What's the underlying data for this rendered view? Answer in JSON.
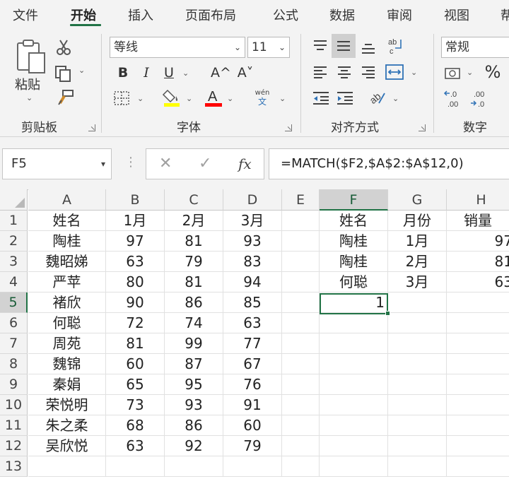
{
  "ribbon": {
    "tabs": [
      "文件",
      "开始",
      "插入",
      "页面布局",
      "公式",
      "数据",
      "审阅",
      "视图",
      "帮"
    ],
    "active_tab": "开始",
    "clipboard": {
      "paste_label": "粘贴",
      "group_label": "剪贴板"
    },
    "font": {
      "name": "等线",
      "size": "11",
      "bold": "B",
      "italic": "I",
      "underline": "U",
      "grow": "A^",
      "shrink": "A˅",
      "phonetic_top": "wén",
      "phonetic_bottom": "文",
      "group_label": "字体",
      "fill_color": "#ffff00",
      "font_color": "#ff0000"
    },
    "alignment": {
      "group_label": "对齐方式"
    },
    "number": {
      "format": "常规",
      "percent": "%",
      "group_label": "数字"
    }
  },
  "formula_bar": {
    "name_box": "F5",
    "cancel": "✕",
    "enter": "✓",
    "fx": "fx",
    "formula": "=MATCH($F2,$A$2:$A$12,0)"
  },
  "sheet": {
    "columns": [
      "A",
      "B",
      "C",
      "D",
      "E",
      "F",
      "G",
      "H"
    ],
    "selected_column": "F",
    "rows": [
      "1",
      "2",
      "3",
      "4",
      "5",
      "6",
      "7",
      "8",
      "9",
      "10",
      "11",
      "12",
      "13"
    ],
    "selected_row": "5",
    "table": [
      [
        "姓名",
        "1月",
        "2月",
        "3月"
      ],
      [
        "陶桂",
        "97",
        "81",
        "93"
      ],
      [
        "魏昭娣",
        "63",
        "79",
        "83"
      ],
      [
        "严苹",
        "80",
        "81",
        "94"
      ],
      [
        "褚欣",
        "90",
        "86",
        "85"
      ],
      [
        "何聪",
        "72",
        "74",
        "63"
      ],
      [
        "周苑",
        "81",
        "99",
        "77"
      ],
      [
        "魏锦",
        "60",
        "87",
        "67"
      ],
      [
        "秦娟",
        "65",
        "95",
        "76"
      ],
      [
        "荣悦明",
        "73",
        "93",
        "91"
      ],
      [
        "朱之柔",
        "68",
        "86",
        "60"
      ],
      [
        "吴欣悦",
        "63",
        "92",
        "79"
      ]
    ],
    "lookup": [
      [
        "姓名",
        "月份",
        "销量"
      ],
      [
        "陶桂",
        "1月",
        "97"
      ],
      [
        "陶桂",
        "2月",
        "81"
      ],
      [
        "何聪",
        "3月",
        "63"
      ]
    ],
    "active_cell_value": "1",
    "accent": "#217346"
  }
}
